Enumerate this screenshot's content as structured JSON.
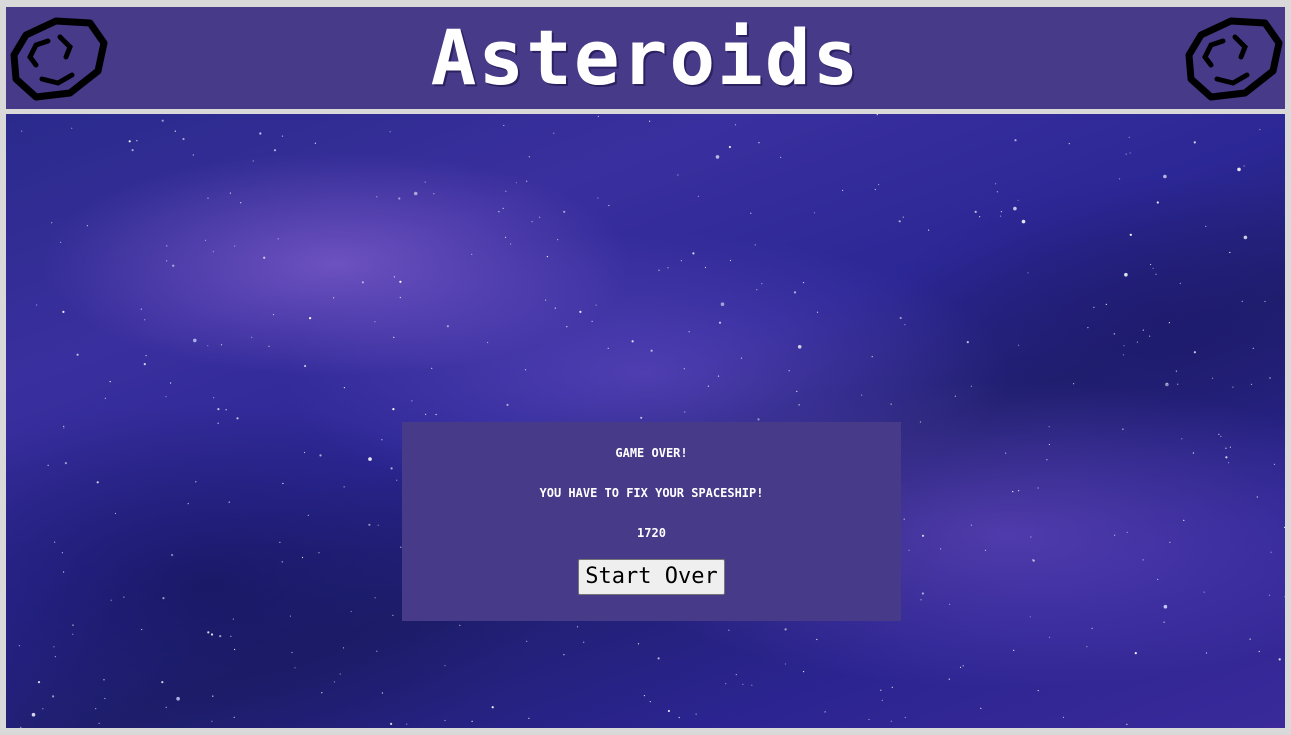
{
  "header": {
    "title": "Asteroids",
    "left_icon": "asteroid-icon",
    "right_icon": "asteroid-icon"
  },
  "dialog": {
    "heading": "GAME OVER!",
    "message": "YOU HAVE TO FIX YOUR SPACESHIP!",
    "score": "1720",
    "start_over_label": "Start Over"
  },
  "colors": {
    "panel": "#463a89",
    "frame": "#d9d9d9",
    "text": "#ffffff"
  }
}
